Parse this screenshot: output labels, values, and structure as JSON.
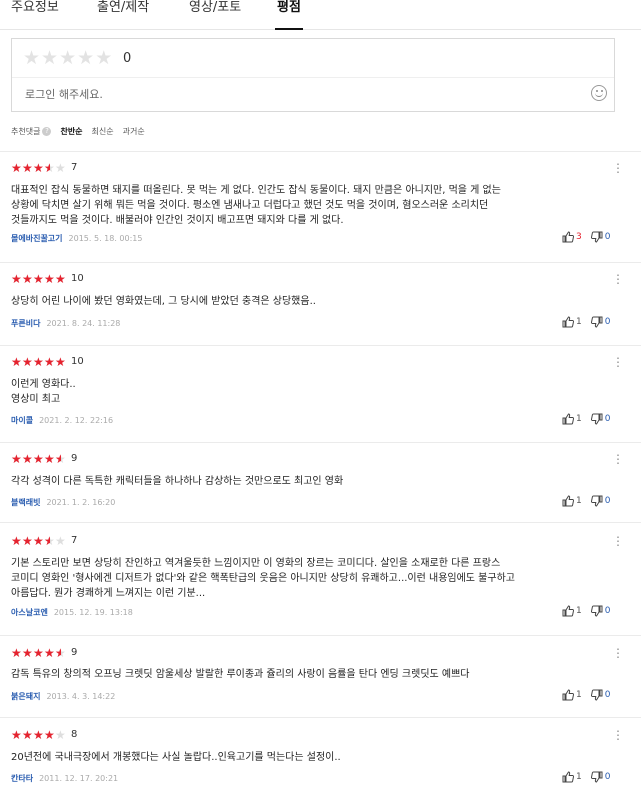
{
  "tabs": [
    "주요정보",
    "출연/제작",
    "영상/포토",
    "평점"
  ],
  "rating_input": {
    "score": "0",
    "login_prompt": "로그인 해주세요."
  },
  "sort": {
    "recommended": "추천댓글",
    "help": "?",
    "options": [
      "찬반순",
      "최신순",
      "과거순"
    ]
  },
  "reviews": [
    {
      "rating": 7,
      "rating_text": "7",
      "text": [
        "대표적인 잡식 동물하면 돼지를 떠올린다. 못 먹는 게 없다. 인간도 잡식 동물이다. 돼지 만큼은 아니지만, 먹을 게 없는",
        "상황에 닥치면 살기 위해 뭐든 먹을 것이다. 평소엔 냄새나고 더럽다고 했던 것도 먹을 것이며, 혐오스러운 소리치던",
        "것들까지도 먹을 것이다. 배불러야 인간인 것이지 배고프면 돼지와 다를 게 없다."
      ],
      "user": "몰에바진꿀고기",
      "date": "2015. 5. 18. 00:15",
      "likes": "3",
      "dislikes": "0"
    },
    {
      "rating": 10,
      "rating_text": "10",
      "text": [
        "상당히 어린 나이에 봤던 영화였는데, 그 당시에 받았던 충격은 상당했음.."
      ],
      "user": "푸른비다",
      "date": "2021. 8. 24. 11:28",
      "likes": "1",
      "dislikes": "0"
    },
    {
      "rating": 10,
      "rating_text": "10",
      "text": [
        "이런게 영화다..",
        "영상미 최고"
      ],
      "user": "마이콜",
      "date": "2021. 2. 12. 22:16",
      "likes": "1",
      "dislikes": "0"
    },
    {
      "rating": 9,
      "rating_text": "9",
      "text": [
        "각각 성격이 다른 독특한 캐릭터들을 하나하나 감상하는 것만으로도 최고인 영화"
      ],
      "user": "블랙래빗",
      "date": "2021. 1. 2. 16:20",
      "likes": "1",
      "dislikes": "0"
    },
    {
      "rating": 7,
      "rating_text": "7",
      "text": [
        "기본 스토리만 보면 상당히 잔인하고 역겨울듯한 느낌이지만 이 영화의 장르는 코미디다. 살인을 소재로한 다른 프랑스",
        "코미디 영화인 '형사에겐 디저트가 없다'와 같은 핵폭탄급의 웃음은 아니지만 상당히 유쾌하고...이런 내용임에도 불구하고",
        "아름답다. 뭔가 경쾌하게 느껴지는 이런 기분..."
      ],
      "user": "아스날코엔",
      "date": "2015. 12. 19. 13:18",
      "likes": "1",
      "dislikes": "0"
    },
    {
      "rating": 9,
      "rating_text": "9",
      "text": [
        "감독 특유의 창의적 오프닝 크렛딧 암울세상 발랄한 루이종과 쥴리의 사랑이 음률을 탄다 엔딩 크렛딧도 예쁘다"
      ],
      "user": "붉은돼지",
      "date": "2013. 4. 3. 14:22",
      "likes": "1",
      "dislikes": "0"
    },
    {
      "rating": 8,
      "rating_text": "8",
      "text": [
        "20년전에 국내극장에서 개봉했다는 사실 놀랍다..인육고기를 먹는다는 설정이.."
      ],
      "user": "칸타타",
      "date": "2011. 12. 17. 20:21",
      "likes": "1",
      "dislikes": "0"
    }
  ]
}
